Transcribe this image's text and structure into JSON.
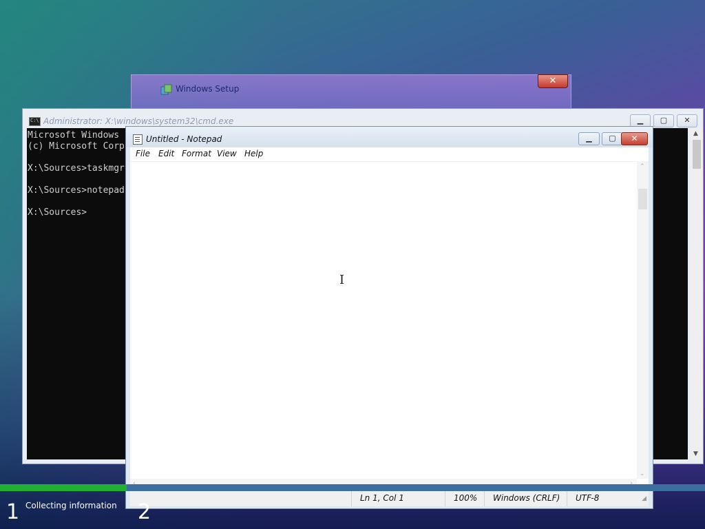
{
  "colors": {
    "progress_fill": "#1fb034",
    "console_bg": "#0c0c0c",
    "close_red": "#c4402f"
  },
  "setup": {
    "title": "Windows Setup",
    "icon": "setup-icon",
    "close_label": "✕",
    "progress_fraction": 0.18,
    "steps": [
      {
        "number": "1",
        "label": "Collecting information"
      },
      {
        "number": "2",
        "label": ""
      }
    ]
  },
  "cmd": {
    "title": "Administrator: X:\\windows\\system32\\cmd.exe",
    "icon_label": "C:\\",
    "controls": {
      "minimize": "▁",
      "maximize": "▢",
      "close": "✕"
    },
    "lines": [
      "Microsoft Windows",
      "(c) Microsoft Corp",
      "",
      "X:\\Sources>taskmgr",
      "",
      "X:\\Sources>notepad",
      "",
      "X:\\Sources>"
    ]
  },
  "notepad": {
    "title": "Untitled - Notepad",
    "controls": {
      "minimize": "▁",
      "maximize": "▢",
      "close": "✕"
    },
    "menu": [
      "File",
      "Edit",
      "Format",
      "View",
      "Help"
    ],
    "content": "",
    "status": {
      "position": "Ln 1, Col 1",
      "zoom": "100%",
      "line_ending": "Windows (CRLF)",
      "encoding": "UTF-8"
    }
  }
}
